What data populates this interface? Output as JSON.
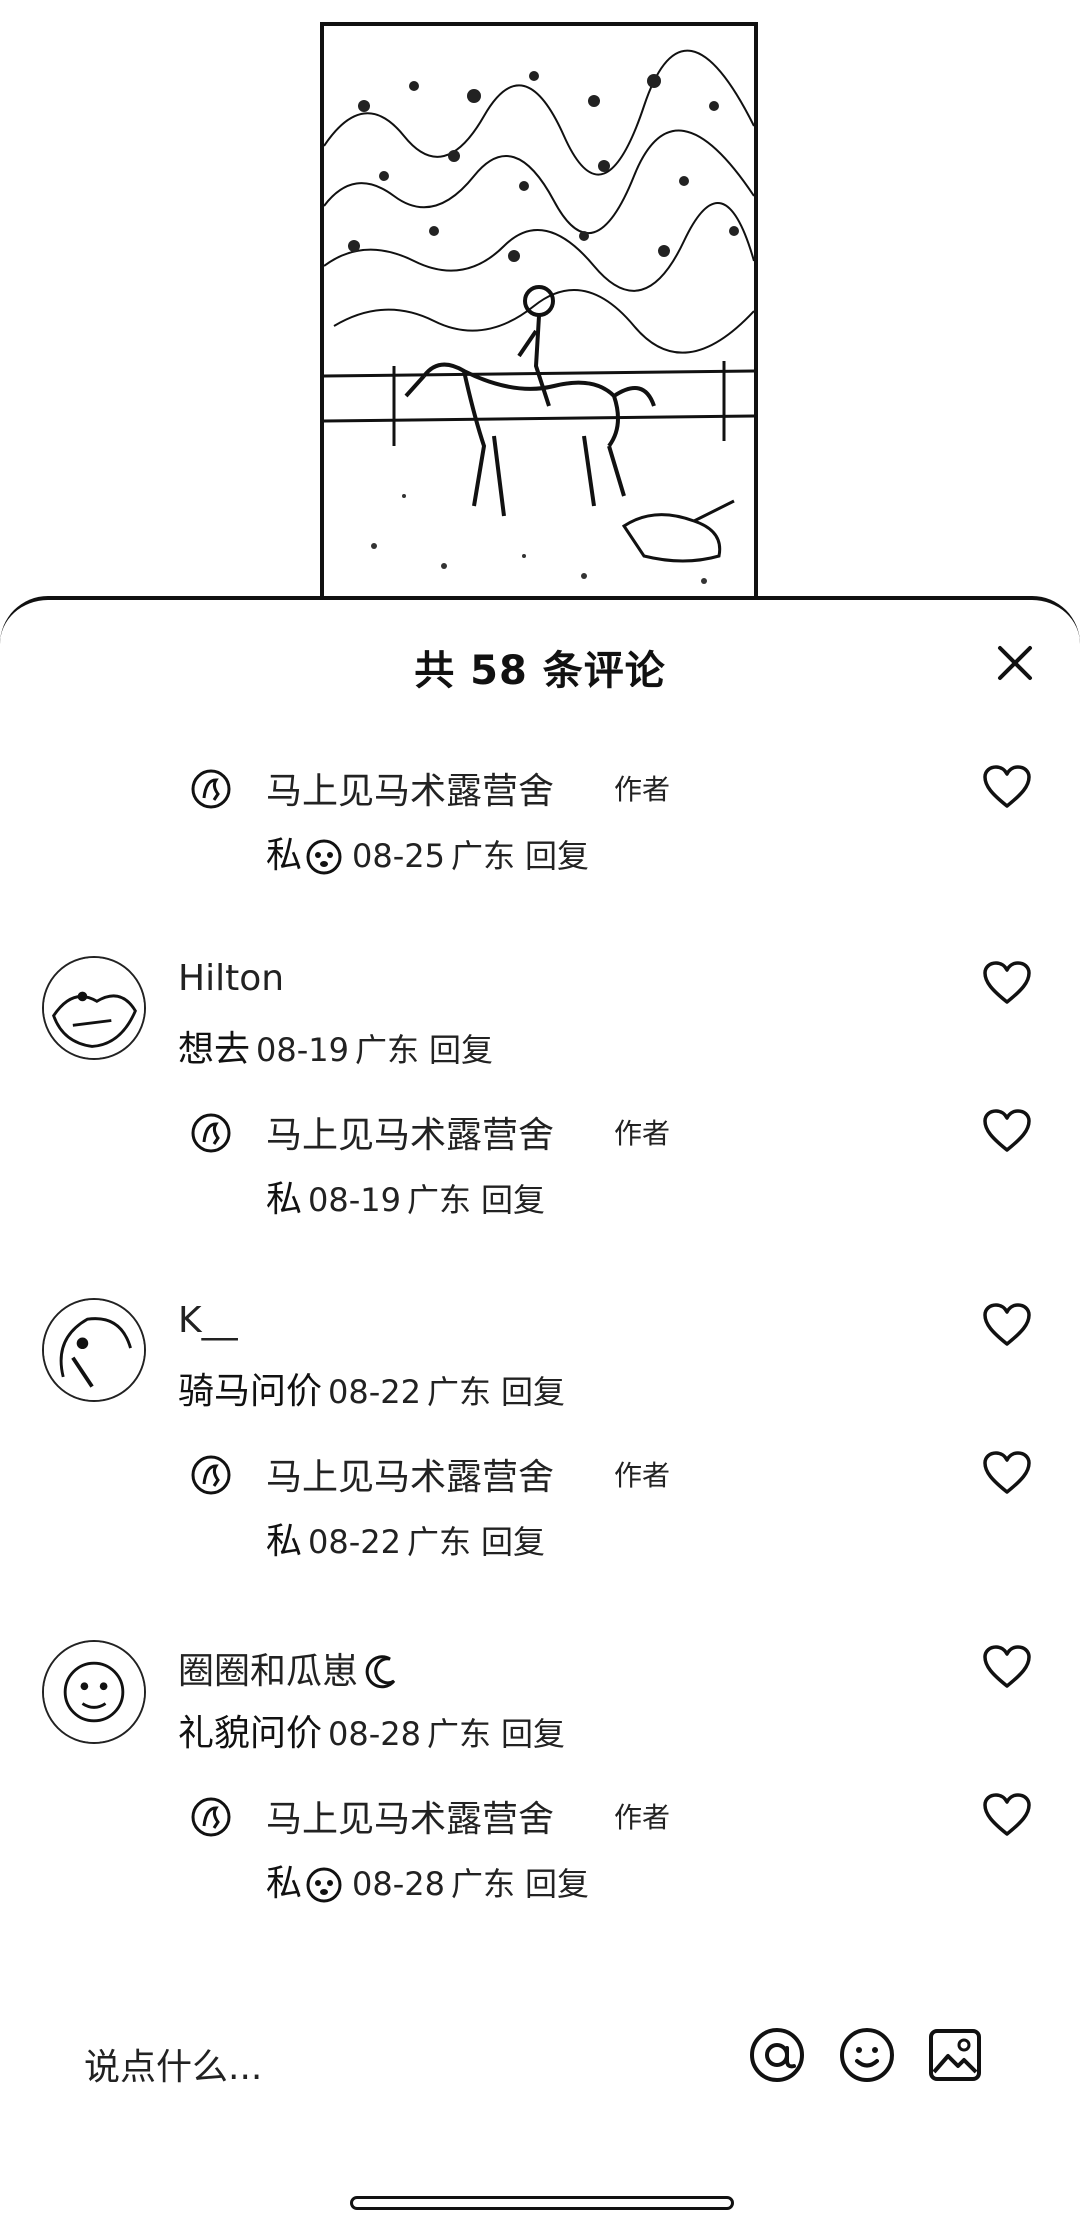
{
  "sheet": {
    "title": "共 58 条评论"
  },
  "comments": [
    {
      "type": "reply",
      "name": "马上见马术露营舍",
      "author_tag": "作者",
      "text": "私",
      "has_emoji": true,
      "date": "08-25",
      "location": "广东",
      "reply_label": "回复"
    },
    {
      "type": "top",
      "name": "Hilton",
      "text": "想去",
      "date": "08-19",
      "location": "广东",
      "reply_label": "回复"
    },
    {
      "type": "reply",
      "name": "马上见马术露营舍",
      "author_tag": "作者",
      "text": "私",
      "date": "08-19",
      "location": "广东",
      "reply_label": "回复"
    },
    {
      "type": "top",
      "name": "K__",
      "text": "骑马问价",
      "date": "08-22",
      "location": "广东",
      "reply_label": "回复"
    },
    {
      "type": "reply",
      "name": "马上见马术露营舍",
      "author_tag": "作者",
      "text": "私",
      "date": "08-22",
      "location": "广东",
      "reply_label": "回复"
    },
    {
      "type": "top",
      "name": "圈圈和瓜崽",
      "name_emoji": "moon",
      "text": "礼貌问价",
      "date": "08-28",
      "location": "广东",
      "reply_label": "回复"
    },
    {
      "type": "reply",
      "name": "马上见马术露营舍",
      "author_tag": "作者",
      "text": "私",
      "has_emoji": true,
      "date": "08-28",
      "location": "广东",
      "reply_label": "回复"
    }
  ],
  "input": {
    "placeholder": "说点什么..."
  },
  "icons": {
    "close": "close-icon",
    "like": "heart-icon",
    "mention": "at-icon",
    "emoji": "smile-icon",
    "image": "image-icon"
  }
}
